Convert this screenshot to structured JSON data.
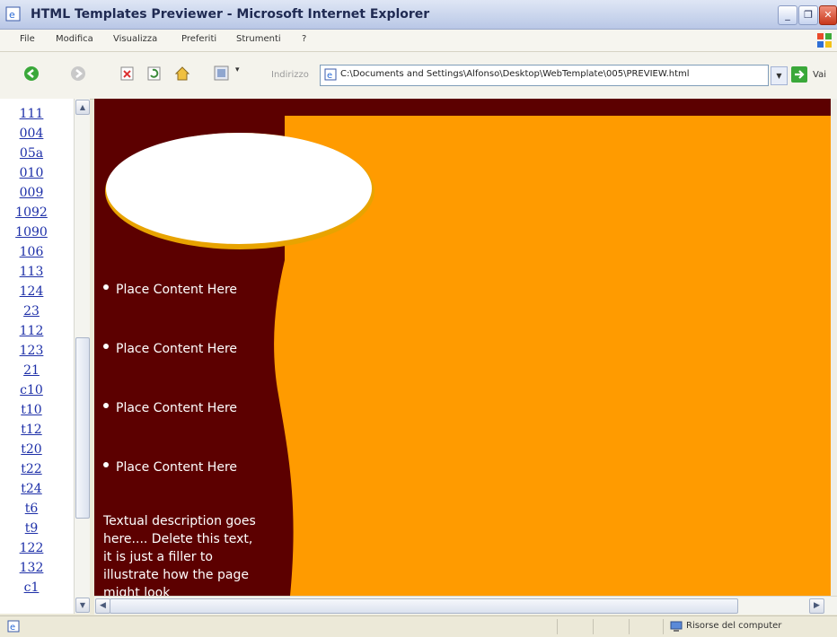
{
  "window": {
    "title": "HTML Templates Previewer - Microsoft Internet Explorer"
  },
  "menu": [
    "File",
    "Modifica",
    "Visualizza",
    "Preferiti",
    "Strumenti",
    "?"
  ],
  "toolbar": {
    "address_label": "Indirizzo",
    "address_value": "C:\\Documents and Settings\\Alfonso\\Desktop\\WebTemplate\\005\\PREVIEW.html",
    "go_label": "Vai"
  },
  "sidebar": {
    "links": [
      "111",
      "004",
      "05a",
      "010",
      "009",
      "1092",
      "1090",
      "106",
      "113",
      "124",
      "23",
      "112",
      "123",
      "21",
      "c10",
      "t10",
      "t12",
      "t20",
      "t22",
      "t24",
      "t6",
      "t9",
      "122",
      "132",
      "c1"
    ]
  },
  "page": {
    "items": [
      "Place Content Here",
      "Place Content Here",
      "Place Content Here",
      "Place Content Here"
    ],
    "description": "Textual description goes here.... Delete this text, it is just a filler to illustrate how the page might look",
    "colors": {
      "dark": "#5c0000",
      "orange": "#ff9b00",
      "oval_border": "#e8a300"
    }
  },
  "status": {
    "zone": "Risorse del computer"
  }
}
